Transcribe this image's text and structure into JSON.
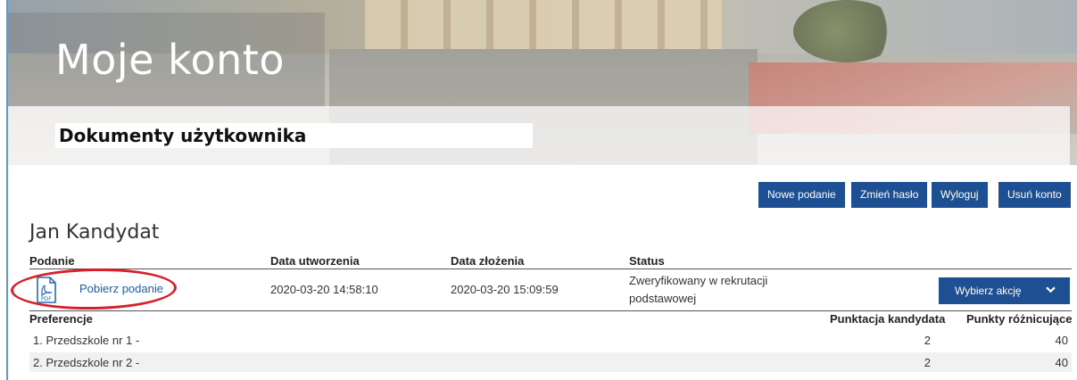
{
  "hero": {
    "title": "Moje konto",
    "subtitle": "Dokumenty użytkownika"
  },
  "toolbar": {
    "new_submission": "Nowe podanie",
    "change_password": "Zmień hasło",
    "logout": "Wyloguj",
    "delete_account": "Usuń konto"
  },
  "user": {
    "name": "Jan Kandydat"
  },
  "table": {
    "headers": {
      "submission": "Podanie",
      "created": "Data utworzenia",
      "submitted": "Data złożenia",
      "status": "Status"
    },
    "row": {
      "link": "Pobierz podanie",
      "created": "2020-03-20 14:58:10",
      "submitted": "2020-03-20 15:09:59",
      "status_line1": "Zweryfikowany w rekrutacji",
      "status_line2": "podstawowej",
      "action": "Wybierz akcję"
    }
  },
  "preferences": {
    "header": "Preferencje",
    "col_points": "Punktacja kandydata",
    "col_diff": "Punkty różnicujące",
    "items": [
      {
        "name": "1. Przedszkole nr 1 -",
        "points": "2",
        "diff": "40"
      },
      {
        "name": "2. Przedszkole nr 2 -",
        "points": "2",
        "diff": "40"
      }
    ]
  },
  "icons": {
    "pdf": "pdf-file-icon",
    "chevron": "chevron-down-icon"
  },
  "colors": {
    "primary_button": "#1e4f92",
    "link": "#1e5ea8",
    "highlight_ellipse": "#d6202b"
  }
}
